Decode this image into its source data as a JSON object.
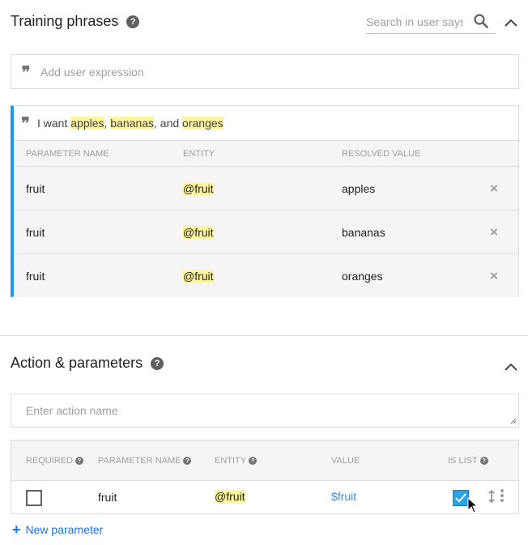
{
  "training": {
    "title": "Training phrases",
    "search_placeholder": "Search in user says",
    "expression_placeholder": "Add user expression",
    "phrase": {
      "prefix": "I want ",
      "e1": "apples",
      "sep1": ", ",
      "e2": "bananas",
      "sep2": ", and ",
      "e3": "oranges"
    },
    "columns": [
      "PARAMETER NAME",
      "ENTITY",
      "RESOLVED VALUE"
    ],
    "rows": [
      {
        "name": "fruit",
        "entity": "@fruit",
        "value": "apples"
      },
      {
        "name": "fruit",
        "entity": "@fruit",
        "value": "bananas"
      },
      {
        "name": "fruit",
        "entity": "@fruit",
        "value": "oranges"
      }
    ],
    "remove_glyph": "×"
  },
  "actions": {
    "title": "Action & parameters",
    "action_placeholder": "Enter action name",
    "columns": {
      "required": "REQUIRED",
      "name": "PARAMETER NAME",
      "entity": "ENTITY",
      "value": "VALUE",
      "is_list": "IS LIST"
    },
    "row": {
      "name": "fruit",
      "entity": "@fruit",
      "value": "$fruit",
      "required": false,
      "is_list": true
    },
    "new_parameter": "New parameter"
  },
  "glyphs": {
    "help": "?",
    "quote": "❞",
    "plus": "+"
  },
  "colors": {
    "accent_blue": "#2196f3",
    "highlight": "#fff59d",
    "link": "#1a73e8"
  }
}
